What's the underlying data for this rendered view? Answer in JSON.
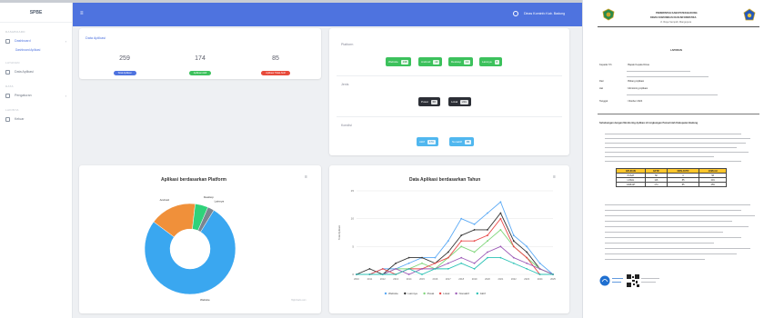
{
  "sidebar": {
    "brand": "SPBE",
    "sections": [
      "DASHBOARD",
      "LAYANAN",
      "DATA",
      "LAINNYA"
    ],
    "items": [
      {
        "label": "Dashboard",
        "sub": "Dashboard Aplikasi"
      },
      {
        "label": "Data Aplikasi"
      },
      {
        "label": "Pengaturan"
      },
      {
        "label": "Keluar"
      }
    ]
  },
  "topbar": {
    "user": "Dinas Kominfo Kab. Badung"
  },
  "summary": {
    "title": "Data Aplikasi",
    "stats": [
      {
        "value": "259",
        "label": "Total Aplikasi",
        "color": "#4e73df"
      },
      {
        "value": "174",
        "label": "Aplikasi Aktif",
        "color": "#3cc15c"
      },
      {
        "value": "85",
        "label": "Aplikasi Tidak Aktif",
        "color": "#e74a3b"
      }
    ]
  },
  "filters": {
    "platform_label": "Platform",
    "platform_buttons": [
      {
        "label": "Website",
        "count": "198"
      },
      {
        "label": "Android",
        "count": "43"
      },
      {
        "label": "Desktop",
        "count": "12"
      },
      {
        "label": "Lainnya",
        "count": "6"
      }
    ],
    "jenis_label": "Jenis",
    "jenis_buttons": [
      {
        "label": "Pusat",
        "count": "58"
      },
      {
        "label": "Lokal",
        "count": "201"
      }
    ],
    "status_label": "Kondisi",
    "status_buttons": [
      {
        "label": "Aktif",
        "count": "174"
      },
      {
        "label": "Nonaktif",
        "count": "85"
      }
    ]
  },
  "charts": {
    "pie_title": "Aplikasi berdasarkan Platform",
    "line_title": "Data Aplikasi berdasarkan Tahun",
    "credit": "Highcharts.com"
  },
  "chart_data": [
    {
      "type": "pie",
      "title": "Aplikasi berdasarkan Platform",
      "slices": [
        {
          "name": "Website",
          "value": 198,
          "color": "#3aa7f0"
        },
        {
          "name": "Android",
          "value": 43,
          "color": "#f0903a"
        },
        {
          "name": "Desktop",
          "value": 12,
          "color": "#2fd27a"
        },
        {
          "name": "Lainnya",
          "value": 6,
          "color": "#7a8590"
        }
      ]
    },
    {
      "type": "line",
      "title": "Data Aplikasi berdasarkan Tahun",
      "ylabel": "Total Aplikasi",
      "x": [
        "2010",
        "2011",
        "2012",
        "2013",
        "2014",
        "2015",
        "2016",
        "2017",
        "2018",
        "2019",
        "2020",
        "2021",
        "2022",
        "2023",
        "2024",
        "2025"
      ],
      "ylim": [
        0,
        15
      ],
      "yticks": [
        0,
        5,
        10,
        15
      ],
      "series": [
        {
          "name": "Website",
          "color": "#5aa9f5",
          "values": [
            0,
            0,
            1,
            1,
            2,
            3,
            3,
            6,
            10,
            9,
            11,
            13,
            7,
            5,
            2,
            0
          ]
        },
        {
          "name": "Lainnya",
          "color": "#333333",
          "values": [
            0,
            1,
            0,
            2,
            3,
            3,
            2,
            4,
            7,
            8,
            8,
            11,
            6,
            4,
            1,
            0
          ]
        },
        {
          "name": "Pusat",
          "color": "#7fd67a",
          "values": [
            0,
            0,
            0,
            1,
            1,
            2,
            1,
            3,
            5,
            4,
            6,
            8,
            5,
            3,
            1,
            0
          ]
        },
        {
          "name": "Lokal",
          "color": "#e94a4a",
          "values": [
            0,
            0,
            1,
            0,
            1,
            1,
            2,
            3,
            6,
            6,
            7,
            10,
            5,
            3,
            0,
            0
          ]
        },
        {
          "name": "Nonaktif",
          "color": "#9b59b6",
          "values": [
            0,
            0,
            0,
            1,
            0,
            1,
            1,
            2,
            3,
            2,
            4,
            5,
            3,
            2,
            1,
            0
          ]
        },
        {
          "name": "Aktif",
          "color": "#2bc2b5",
          "values": [
            0,
            0,
            0,
            0,
            1,
            0,
            1,
            1,
            2,
            1,
            3,
            3,
            2,
            1,
            0,
            0
          ]
        }
      ]
    }
  ],
  "document": {
    "kop_1": "PEMERINTAH KABUPATEN BADUNG",
    "kop_2": "DINAS KOMUNIKASI DAN INFORMATIKA",
    "kop_3": "Jl. Raya Sempidi, Mangupura",
    "heading": "LAPORAN",
    "fields": [
      {
        "k": "Kepada Yth",
        "v": ": Bapak Kepala Dinas"
      },
      {
        "k": "Dari",
        "v": ": Bidang Aplikasi"
      },
      {
        "k": "Hal",
        "v": ": Monitoring Aplikasi"
      },
      {
        "k": "Tanggal",
        "v": ": Oktober 2024"
      }
    ],
    "intro": "Sehubungan dengan Monitoring Aplikasi di Lingkungan Pemerintah Kabupaten Badung",
    "table_head": [
      "APLIKASI",
      "AKTIF",
      "NON AKTIF",
      "JUMLAH"
    ],
    "table_rows": [
      [
        "PUSAT",
        "58",
        "0",
        "58"
      ],
      [
        "LOKAL",
        "116",
        "85",
        "201"
      ],
      [
        "JUMLAH",
        "174",
        "85",
        "259"
      ]
    ]
  }
}
